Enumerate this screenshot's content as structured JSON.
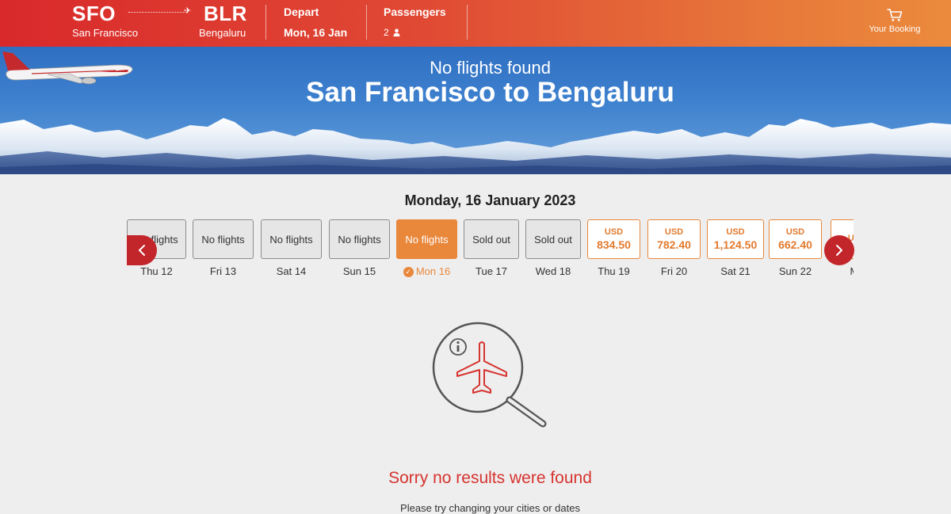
{
  "header": {
    "origin_code": "SFO",
    "origin_city": "San Francisco",
    "destination_code": "BLR",
    "destination_city": "Bengaluru",
    "depart_label": "Depart",
    "depart_value": "Mon, 16 Jan",
    "passengers_label": "Passengers",
    "passengers_count": "2",
    "booking_label": "Your Booking",
    "gradient_start": "#d9292b",
    "gradient_end": "#eb8a3c"
  },
  "banner": {
    "subtitle": "No flights found",
    "title": "San Francisco to Bengaluru"
  },
  "date_title": "Monday, 16 January 2023",
  "days": [
    {
      "box": "No flights",
      "label": "Thu 12",
      "kind": "none"
    },
    {
      "box": "No flights",
      "label": "Fri 13",
      "kind": "none"
    },
    {
      "box": "No flights",
      "label": "Sat 14",
      "kind": "none"
    },
    {
      "box": "No flights",
      "label": "Sun 15",
      "kind": "none"
    },
    {
      "box": "No flights",
      "label": "Mon 16",
      "kind": "selected"
    },
    {
      "box": "Sold out",
      "label": "Tue 17",
      "kind": "none"
    },
    {
      "box": "Sold out",
      "label": "Wed 18",
      "kind": "none"
    },
    {
      "currency": "USD",
      "amount": "834.50",
      "label": "Thu 19",
      "kind": "price"
    },
    {
      "currency": "USD",
      "amount": "782.40",
      "label": "Fri 20",
      "kind": "price"
    },
    {
      "currency": "USD",
      "amount": "1,124.50",
      "label": "Sat 21",
      "kind": "price"
    },
    {
      "currency": "USD",
      "amount": "662.40",
      "label": "Sun 22",
      "kind": "price"
    },
    {
      "currency": "USD",
      "amount": "",
      "label": "Mo",
      "kind": "price"
    }
  ],
  "icons": {
    "prev": "chevron-left-icon",
    "next": "chevron-right-icon",
    "cart": "cart-icon",
    "passenger": "person-icon",
    "selected": "check-circle-icon",
    "empty_state": "no-flights-search-icon"
  },
  "colors": {
    "accent_orange": "#e9873b",
    "accent_red": "#c2252a",
    "error_text": "#d6332f"
  },
  "empty_state": {
    "message": "Sorry no results were found",
    "hint": "Please try changing your cities or dates"
  }
}
